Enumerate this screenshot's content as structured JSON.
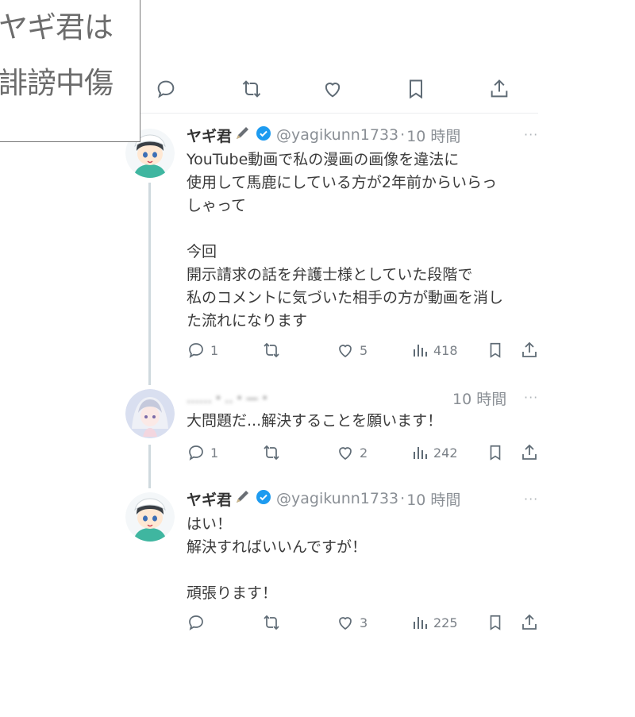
{
  "overlay": {
    "line1": "ヤギ君は",
    "line2": "誹謗中傷"
  },
  "tweets": [
    {
      "name": "ヤギ君",
      "handle": "@yagikunn1733",
      "separator": "·",
      "time": "10 時間",
      "more": "···",
      "text": "YouTube動画で私の漫画の画像を違法に\n使用して馬鹿にしている方が2年前からいらっ\nしゃって\n\n今回\n開示請求の話を弁護士様としていた段階で\n私のコメントに気づいた相手の方が動画を消し\nた流れになります",
      "replies": "1",
      "likes": "5",
      "views": "418"
    },
    {
      "name_blurred": "……・‥・—・",
      "time": "10 時間",
      "more": "···",
      "text": "大問題だ...解決することを願います！",
      "replies": "1",
      "likes": "2",
      "views": "242"
    },
    {
      "name": "ヤギ君",
      "handle": "@yagikunn1733",
      "separator": "·",
      "time": "10 時間",
      "more": "···",
      "text": "はい！\n解決すればいいんですが！\n\n頑張ります！",
      "replies": "",
      "likes": "3",
      "views": "225"
    }
  ],
  "colors": {
    "verified": "#1d9bf0",
    "icon": "#5f6b75",
    "thread": "#cfd9de"
  }
}
